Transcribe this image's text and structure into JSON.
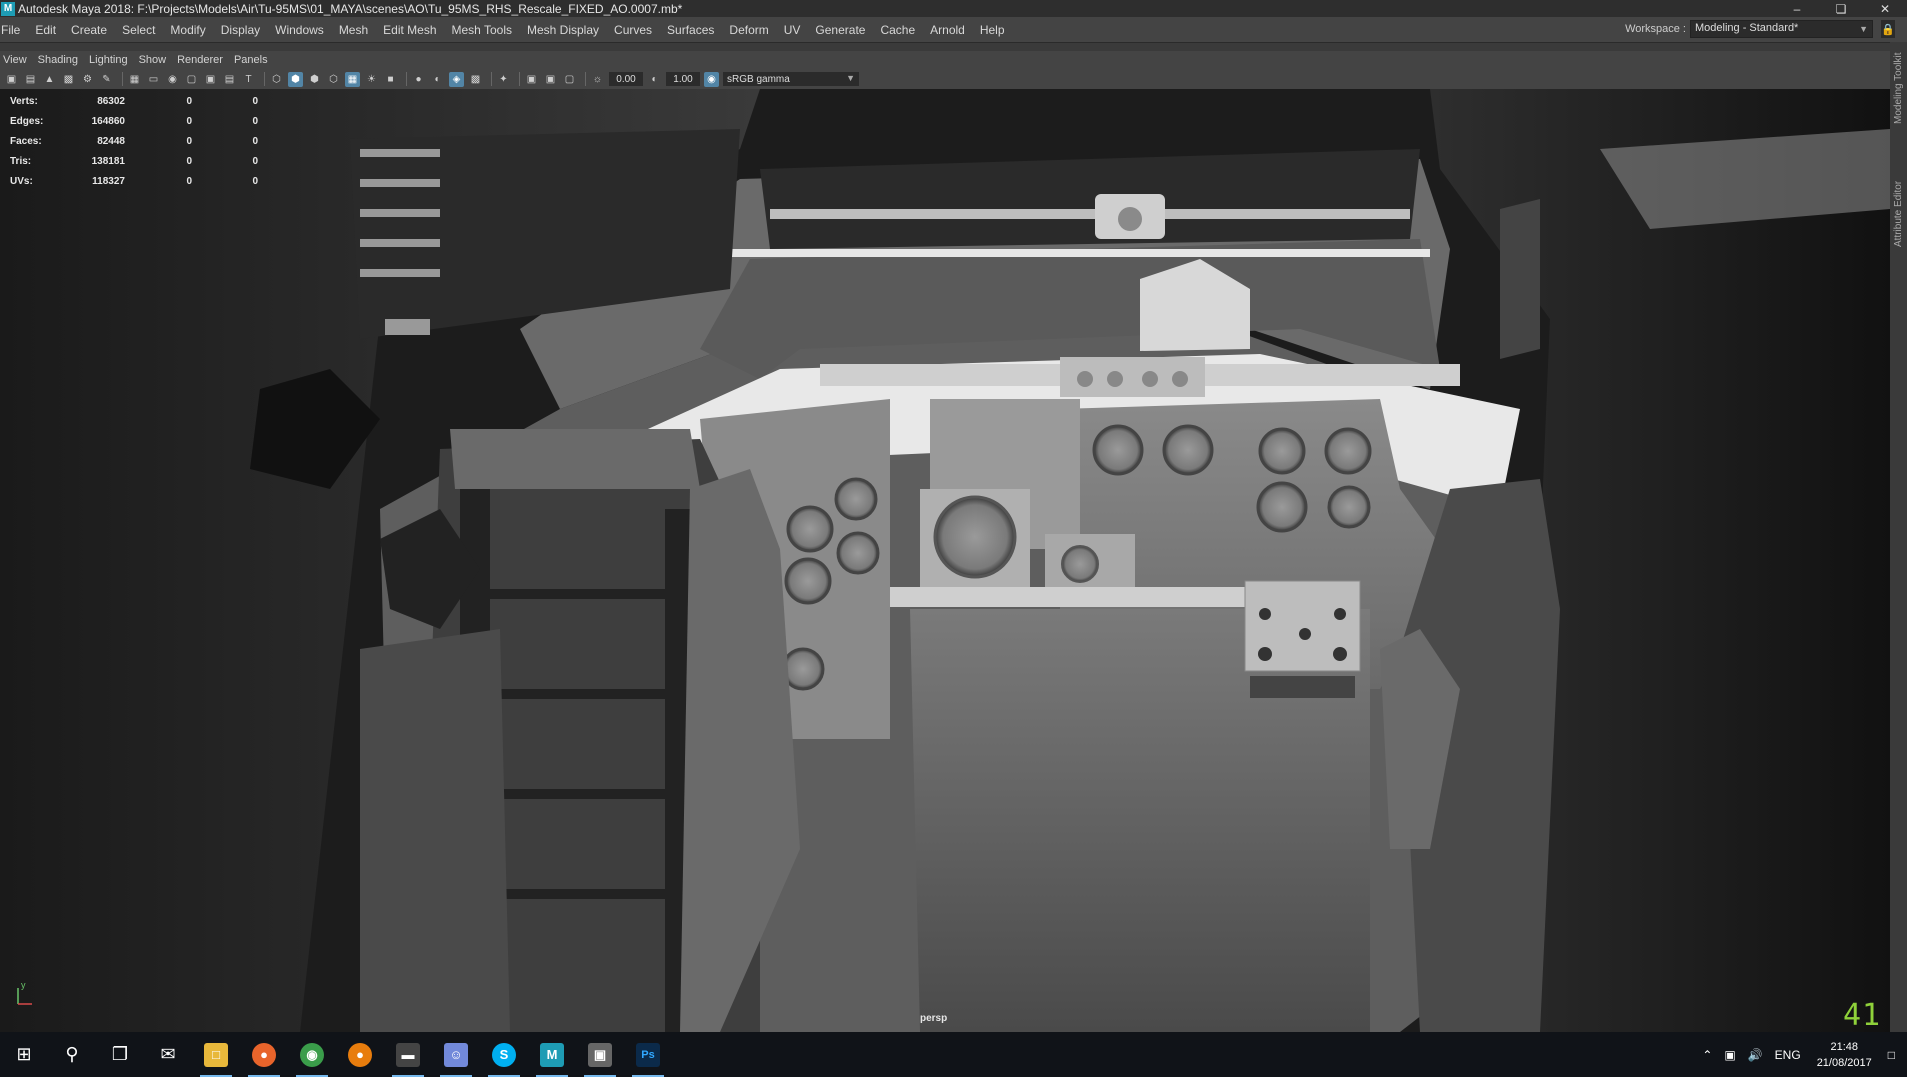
{
  "window": {
    "title": "Autodesk Maya 2018: F:\\Projects\\Models\\Air\\Tu-95MS\\01_MAYA\\scenes\\AO\\Tu_95MS_RHS_Rescale_FIXED_AO.0007.mb*",
    "app_icon": "M",
    "controls": [
      "minimize-icon",
      "restore-icon",
      "close-icon"
    ]
  },
  "menubar": {
    "items": [
      "File",
      "Edit",
      "Create",
      "Select",
      "Modify",
      "Display",
      "Windows",
      "Mesh",
      "Edit Mesh",
      "Mesh Tools",
      "Mesh Display",
      "Curves",
      "Surfaces",
      "Deform",
      "UV",
      "Generate",
      "Cache",
      "Arnold",
      "Help"
    ]
  },
  "workspace": {
    "label": "Workspace :",
    "value": "Modeling - Standard*"
  },
  "panel_menu": {
    "items": [
      "View",
      "Shading",
      "Lighting",
      "Show",
      "Renderer",
      "Panels"
    ]
  },
  "view_toolbar": {
    "exposure": "0.00",
    "gamma": "1.00",
    "color_space": "sRGB gamma"
  },
  "side_tabs": [
    "Modeling Toolkit",
    "Attribute Editor"
  ],
  "hud": {
    "rows": [
      {
        "label": "Verts:",
        "values": [
          "86302",
          "0",
          "0"
        ]
      },
      {
        "label": "Edges:",
        "values": [
          "164860",
          "0",
          "0"
        ]
      },
      {
        "label": "Faces:",
        "values": [
          "82448",
          "0",
          "0"
        ]
      },
      {
        "label": "Tris:",
        "values": [
          "138181",
          "0",
          "0"
        ]
      },
      {
        "label": "UVs:",
        "values": [
          "118327",
          "0",
          "0"
        ]
      }
    ]
  },
  "viewport": {
    "camera": "persp",
    "frame": "41",
    "axis_y": "y"
  },
  "taskbar": {
    "lang": "ENG",
    "time": "21:48",
    "date": "21/08/2017"
  },
  "colors": {
    "maya_accent": "#1e9cb4",
    "frame_counter": "#8fd13a",
    "toolbar_active": "#5285a6",
    "taskbar_bg": "#101318"
  }
}
